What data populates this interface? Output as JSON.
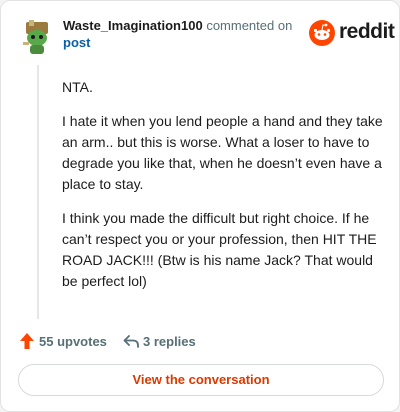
{
  "comment": {
    "username": "Waste_Imagination100",
    "commented_on_text": "commented on",
    "post_link_label": "post",
    "body_paragraphs": [
      "NTA.",
      "I hate it when you lend people a hand and they take an arm.. but this is worse. What a loser to have to degrade you like that, when he doesn’t even have a place to stay.",
      "I think you made the difficult but right choice. If he can’t respect you or your profession, then HIT THE ROAD JACK!!! (Btw is his name Jack? That would be perfect lol)"
    ],
    "upvotes_label": "55 upvotes",
    "replies_label": "3 replies"
  },
  "brand": {
    "wordmark": "reddit",
    "color": "#ff4500"
  },
  "cta": {
    "label": "View the conversation",
    "color": "#d93a00"
  },
  "icons": {
    "avatar": "snoo-avatar-icon",
    "logo": "reddit-logo-icon",
    "upvote": "upvote-arrow-icon",
    "reply": "reply-arrow-icon"
  }
}
